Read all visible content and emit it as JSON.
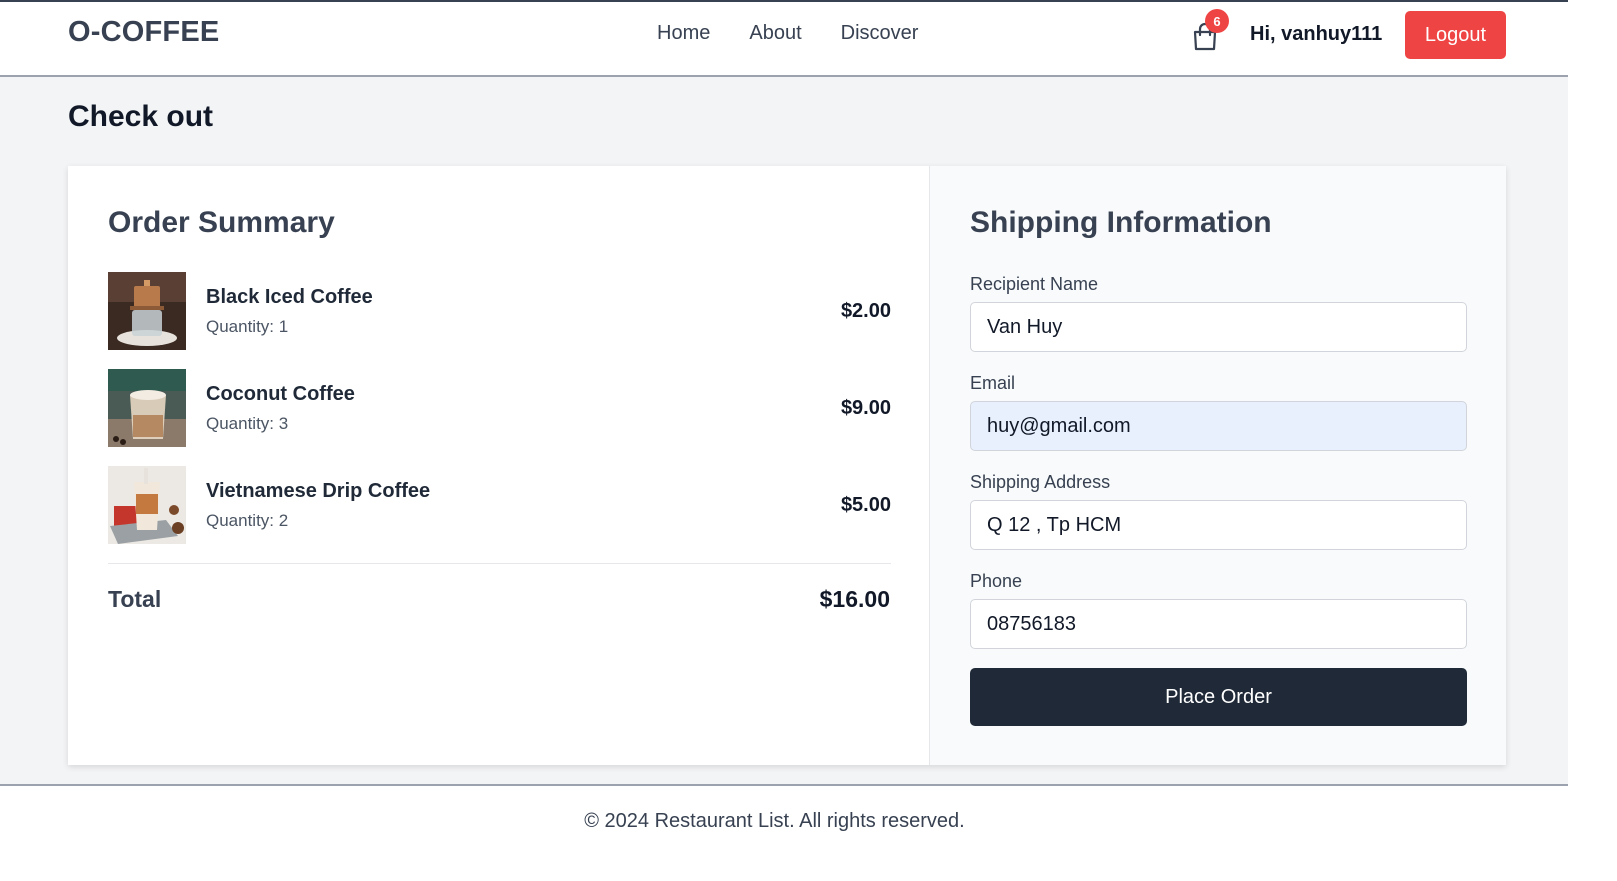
{
  "header": {
    "brand": "O-COFFEE",
    "nav": [
      "Home",
      "About",
      "Discover"
    ],
    "cart_count": "6",
    "greeting": "Hi, vanhuy111",
    "logout_label": "Logout"
  },
  "page": {
    "title": "Check out"
  },
  "order_summary": {
    "title": "Order Summary",
    "items": [
      {
        "name": "Black Iced Coffee",
        "quantity": "Quantity: 1",
        "price": "$2.00"
      },
      {
        "name": "Coconut Coffee",
        "quantity": "Quantity: 3",
        "price": "$9.00"
      },
      {
        "name": "Vietnamese Drip Coffee",
        "quantity": "Quantity: 2",
        "price": "$5.00"
      }
    ],
    "total_label": "Total",
    "total_value": "$16.00"
  },
  "shipping": {
    "title": "Shipping Information",
    "fields": [
      {
        "label": "Recipient Name",
        "value": "Van Huy"
      },
      {
        "label": "Email",
        "value": "huy@gmail.com"
      },
      {
        "label": "Shipping Address",
        "value": "Q 12 , Tp HCM"
      },
      {
        "label": "Phone",
        "value": "08756183"
      }
    ],
    "place_order_label": "Place Order"
  },
  "footer": {
    "text": "© 2024 Restaurant List. All rights reserved."
  },
  "colors": {
    "accent_red": "#ef4444",
    "dark_button": "#1f2937",
    "autofill_bg": "#e8f0fe"
  }
}
